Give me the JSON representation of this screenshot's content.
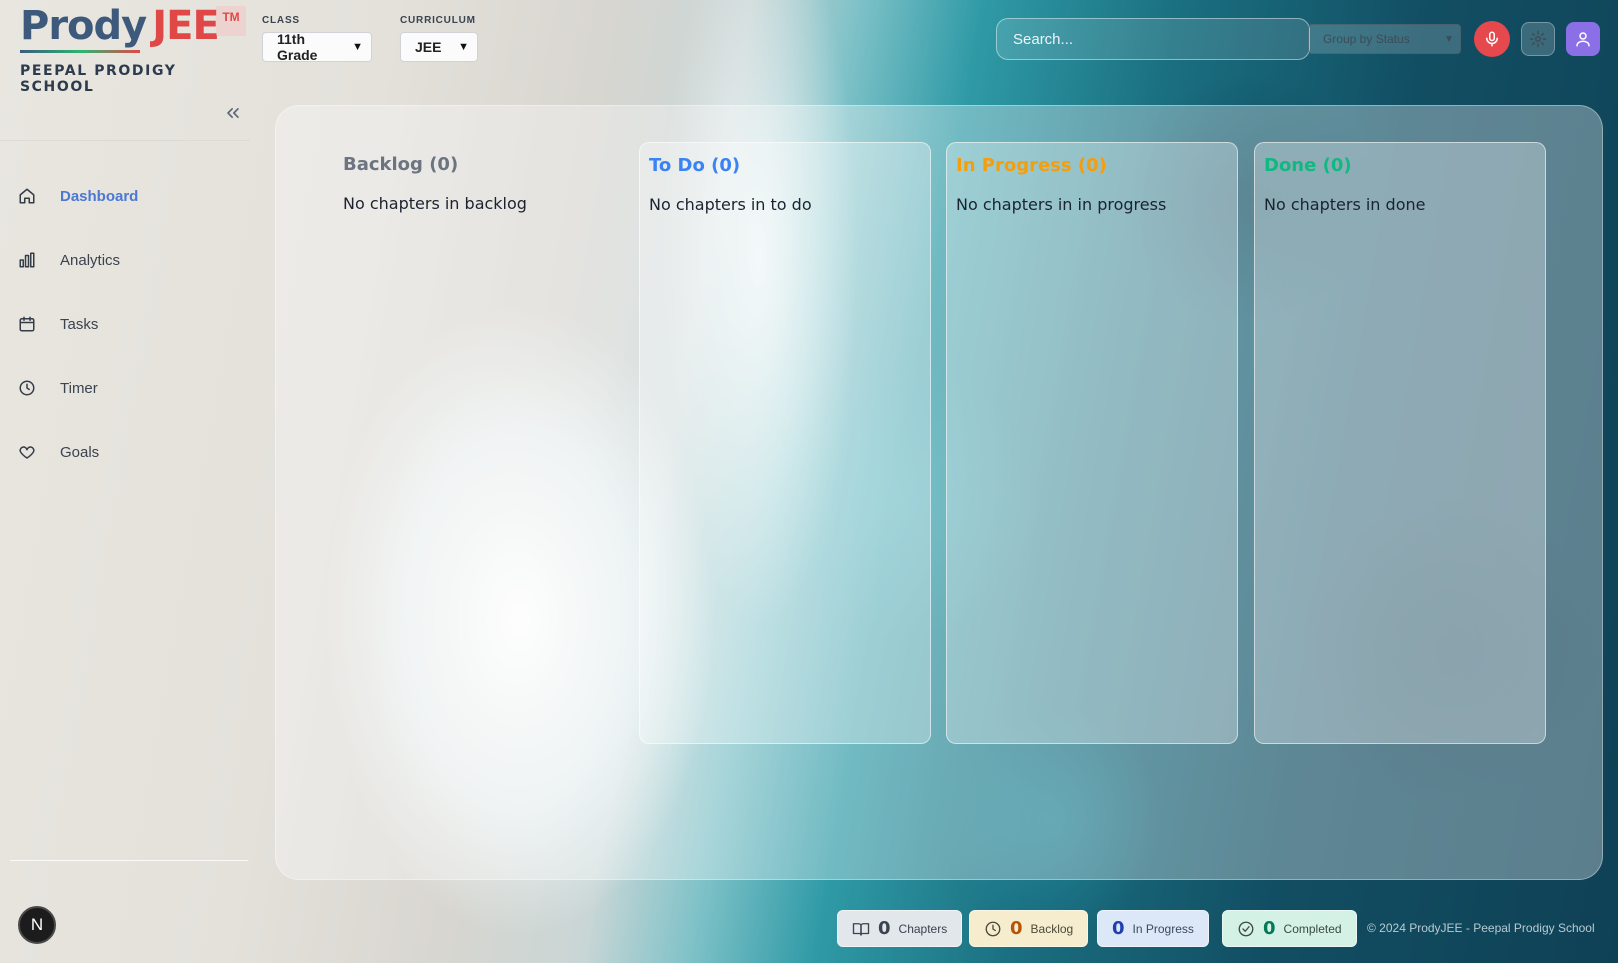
{
  "brand": {
    "prody": "Prody",
    "jee": "JEE",
    "tm": "TM",
    "school": "PEEPAL PRODIGY SCHOOL"
  },
  "filters": {
    "class_label": "CLASS",
    "class_value": "11th Grade",
    "curriculum_label": "CURRICULUM",
    "curriculum_value": "JEE"
  },
  "search": {
    "placeholder": "Search..."
  },
  "group_by": {
    "value": "Group by Status"
  },
  "sidebar": {
    "collapse_icon": "chevrons-left-icon",
    "items": [
      {
        "label": "Dashboard",
        "icon": "home-icon",
        "active": true
      },
      {
        "label": "Analytics",
        "icon": "bar-chart-icon",
        "active": false
      },
      {
        "label": "Tasks",
        "icon": "calendar-icon",
        "active": false
      },
      {
        "label": "Timer",
        "icon": "clock-icon",
        "active": false
      },
      {
        "label": "Goals",
        "icon": "heart-icon",
        "active": false
      }
    ],
    "user_initial": "N"
  },
  "board": {
    "columns": [
      {
        "title": "Backlog (0)",
        "empty": "No chapters in backlog",
        "color": "#6b7480"
      },
      {
        "title": "To Do (0)",
        "empty": "No chapters in to do",
        "color": "#3b82f6"
      },
      {
        "title": "In Progress (0)",
        "empty": "No chapters in in progress",
        "color": "#f59e0b"
      },
      {
        "title": "Done (0)",
        "empty": "No chapters in done",
        "color": "#10b981"
      }
    ]
  },
  "footer": {
    "stats": [
      {
        "num": "0",
        "label": "Chapters",
        "icon": "book-icon",
        "bg": "#e2e7ec",
        "fg": "#3b4350"
      },
      {
        "num": "0",
        "label": "Backlog",
        "icon": "clock-icon",
        "bg": "#f5edcd",
        "fg": "#b45309"
      },
      {
        "num": "0",
        "label": "In Progress",
        "icon": "",
        "bg": "#dce8f7",
        "fg": "#1e40af"
      },
      {
        "num": "0",
        "label": "Completed",
        "icon": "check-circle-icon",
        "bg": "#d4f1e6",
        "fg": "#047857"
      }
    ],
    "copyright": "© 2024 ProdyJEE - Peepal Prodigy School"
  }
}
